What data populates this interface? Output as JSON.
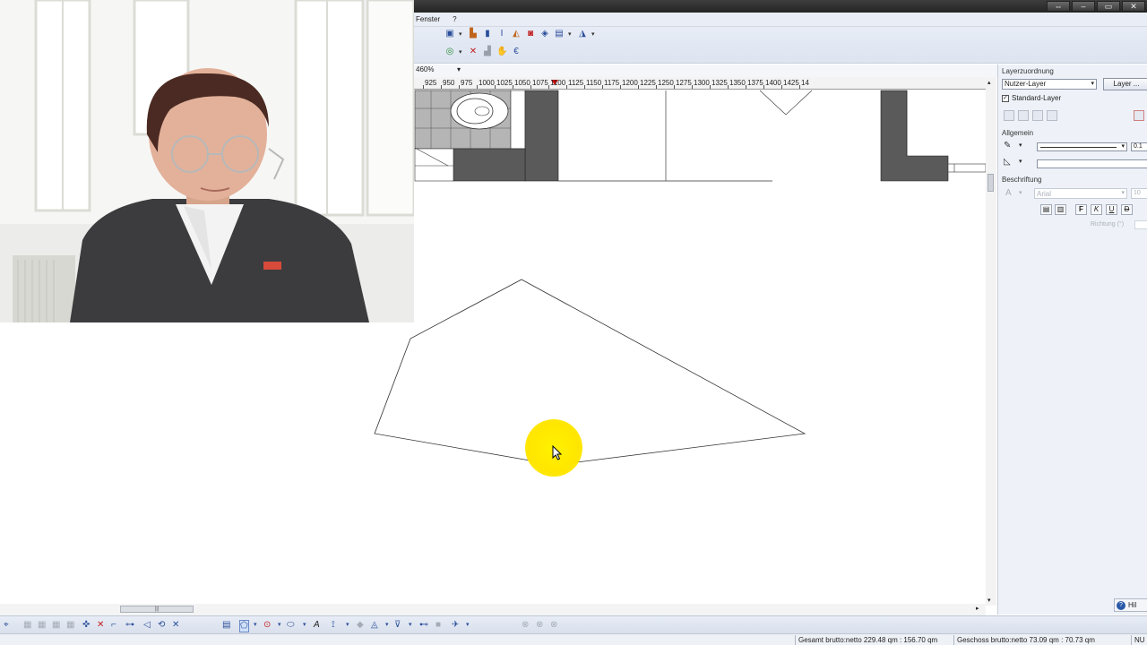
{
  "window": {
    "controls": [
      "⇔",
      "–",
      "▭",
      "✕"
    ]
  },
  "menubar": {
    "items": [
      "Fenster",
      "?"
    ]
  },
  "zoom": {
    "value": "460%"
  },
  "ruler": {
    "labels": [
      "925",
      "950",
      "975",
      "1000",
      "1025",
      "1050",
      "1075",
      "1100",
      "1125",
      "1150",
      "1175",
      "1200",
      "1225",
      "1250",
      "1275",
      "1300",
      "1325",
      "1350",
      "1375",
      "1400",
      "1425",
      "14"
    ]
  },
  "panel": {
    "section_layer": "Layerzuordnung",
    "layer_select": "Nutzer-Layer",
    "layer_button": "Layer ...",
    "standard_layer_label": "Standard-Layer",
    "standard_layer_checked": true,
    "section_general": "Allgemein",
    "line_width_value": "0.1",
    "section_label": "Beschriftung",
    "font_select": "Arial",
    "font_size_value": "10",
    "format_buttons": [
      "F",
      "K",
      "U",
      "D"
    ],
    "direction_label": "Richtung (°)",
    "help_label": "Hil"
  },
  "hscroll": {
    "thumb_grip": "|||"
  },
  "status": {
    "gross_total": "Gesamt brutto:netto 229.48 qm : 156.70 qm",
    "gross_floor": "Geschoss brutto:netto 73.09 qm : 70.73 qm",
    "numlock": "NU"
  },
  "colors": {
    "highlight": "#ffe600",
    "wall_fill": "#5a5a5a",
    "titlebar": "#2f2f2f",
    "panel_bg": "#eef2f8"
  }
}
